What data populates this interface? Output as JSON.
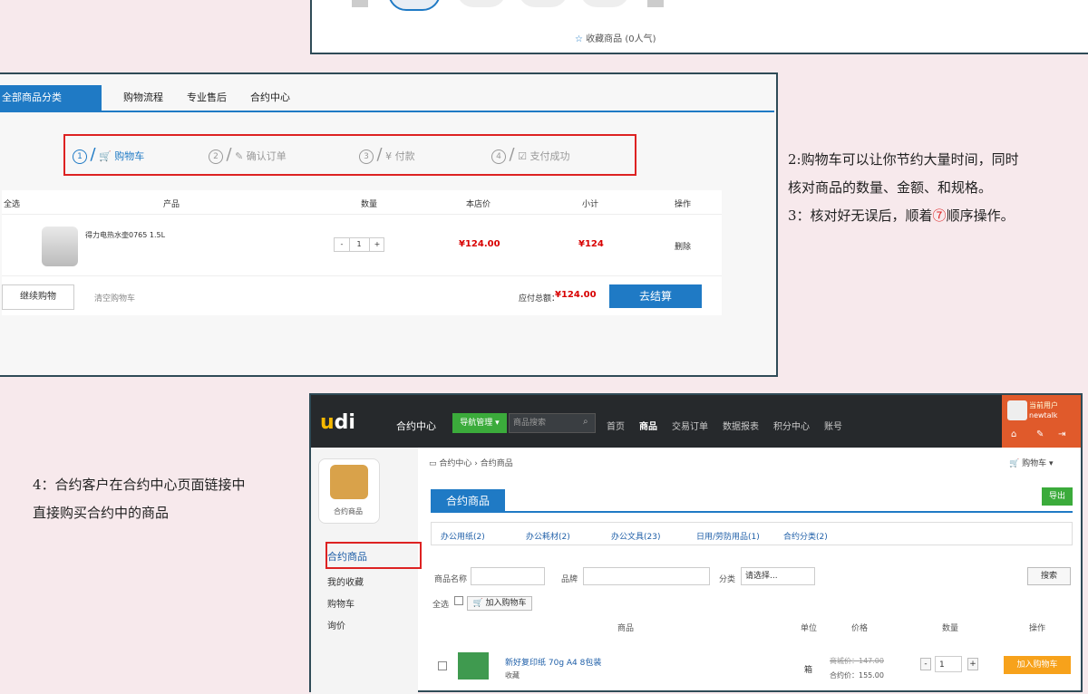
{
  "panel1": {
    "fav_label": "收藏商品 (0人气)"
  },
  "panel2": {
    "category_tab": "全部商品分类",
    "nav": [
      "购物流程",
      "专业售后",
      "合约中心"
    ],
    "steps": [
      {
        "num": "1",
        "label": "购物车"
      },
      {
        "num": "2",
        "label": "确认订单"
      },
      {
        "num": "3",
        "label": "付款"
      },
      {
        "num": "4",
        "label": "支付成功"
      }
    ],
    "table_headers": {
      "select_all": "全选",
      "product": "产品",
      "qty": "数量",
      "price": "本店价",
      "subtotal": "小计",
      "action": "操作"
    },
    "item": {
      "name": "得力电热水壶0765 1.5L",
      "qty": "1",
      "minus": "-",
      "plus": "+",
      "price": "¥124.00",
      "subtotal": "¥124",
      "delete": "删除"
    },
    "continue_btn": "继续购物",
    "clear_cart": "清空购物车",
    "total_label": "应付总额：",
    "total_value": "¥124.00",
    "checkout_btn": "去结算"
  },
  "notes_right": {
    "line1": "2:购物车可以让你节约大量时间，同时",
    "line2": "核对商品的数量、金额、和规格。",
    "line3_pre": "3：核对好无误后，顺着",
    "line3_mark": "⑦",
    "line3_post": "顺序操作。"
  },
  "notes_left": {
    "line1": "4：合约客户在合约中心页面链接中",
    "line2": "直接购买合约中的商品"
  },
  "panel3": {
    "logo_u": "u",
    "logo_rest": "di",
    "header_title": "合约中心",
    "nav_manage": "导航管理 ▾",
    "search_placeholder": "商品搜索",
    "nav": [
      "首页",
      "商品",
      "交易订单",
      "数据报表",
      "积分中心",
      "账号"
    ],
    "user_title": "当前用户",
    "user_name": "newtalk",
    "sidebar_logo_label": "合约商品",
    "sidebar": [
      "合约商品",
      "我的收藏",
      "购物车",
      "询价"
    ],
    "breadcrumb": "合约中心 › 合约商品",
    "cart_dropdown": "购物车 ▾",
    "section_title": "合约商品",
    "export_btn": "导出",
    "filters": [
      "办公用纸(2)",
      "办公耗材(2)",
      "办公文具(23)",
      "日用/劳防用品(1)",
      "合约分类(2)"
    ],
    "name_label": "商品名称",
    "brand_label": "品牌",
    "category_label": "分类",
    "category_select": "请选择...",
    "search_btn": "搜索",
    "select_all": "全选",
    "add_cart_btn": "加入购物车",
    "grid_headers": [
      "商品",
      "单位",
      "价格",
      "数量",
      "操作"
    ],
    "product": {
      "name": "新好复印纸 70g A4 8包装",
      "fav": "收藏",
      "unit": "箱",
      "market_price": "商城价：147.00",
      "contract_price": "合约价：155.00",
      "qty": "1",
      "add_btn": "加入购物车"
    }
  }
}
